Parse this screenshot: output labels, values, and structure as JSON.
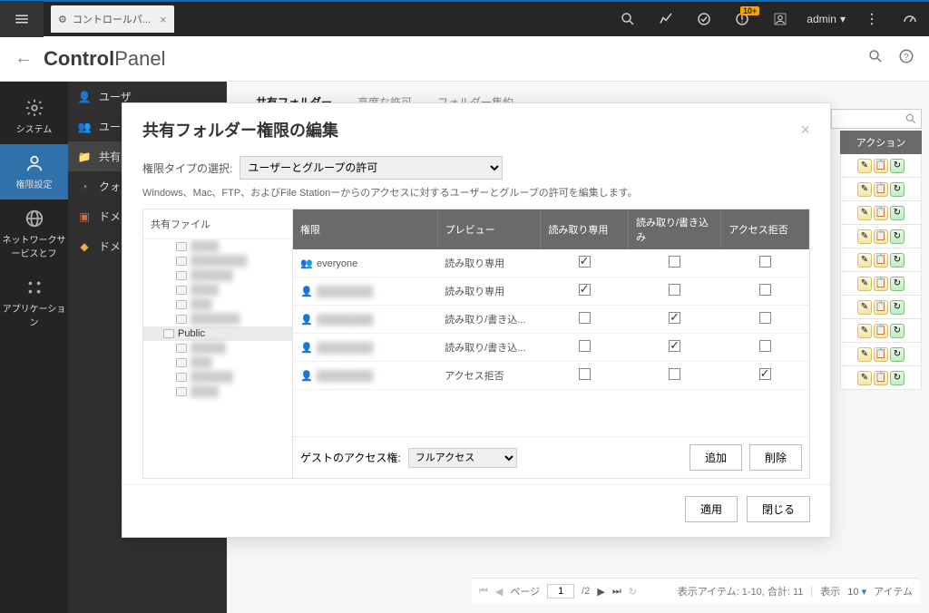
{
  "topbar": {
    "tab_title": "コントロールパ...",
    "notification_badge": "10+",
    "user": "admin"
  },
  "header": {
    "title_bold": "Control",
    "title_light": "Panel"
  },
  "leftbar": {
    "items": [
      {
        "label": "システム"
      },
      {
        "label": "権限設定"
      },
      {
        "label": "ネットワークサービスとフ"
      },
      {
        "label": "アプリケーション"
      }
    ]
  },
  "sublist": {
    "items": [
      {
        "label": "ユーザ"
      },
      {
        "label": "ユー"
      },
      {
        "label": "共有"
      },
      {
        "label": "クォ"
      },
      {
        "label": "ドメ"
      },
      {
        "label": "ドメ"
      }
    ]
  },
  "tabs": {
    "items": [
      "共有フォルダー",
      "高度な許可",
      "フォルダー集約"
    ]
  },
  "bg": {
    "actions_header": "アクション",
    "pager_page_label": "ページ",
    "pager_page": "1",
    "pager_total": "/2",
    "pager_summary": "表示アイテム: 1-10, 合計: 11",
    "pager_show_label": "表示",
    "pager_show_value": "10",
    "pager_items": "アイテム"
  },
  "modal": {
    "title": "共有フォルダー権限の編集",
    "perm_type_label": "権限タイプの選択:",
    "perm_type_value": "ユーザーとグループの許可",
    "desc": "Windows、Mac、FTP、およびFile Stationーからのアクセスに対するユーザーとグループの許可を編集します。",
    "tree_header": "共有ファイル",
    "tree_selected": "Public",
    "table": {
      "headers": [
        "権限",
        "プレビュー",
        "読み取り専用",
        "読み取り/書き込み",
        "アクセス拒否"
      ],
      "rows": [
        {
          "icon": "group",
          "name": "everyone",
          "preview": "読み取り専用",
          "pv_class": "pv-orange",
          "ro": true,
          "rw": false,
          "deny": false
        },
        {
          "icon": "user",
          "name": "",
          "preview": "読み取り専用",
          "pv_class": "pv-orange",
          "ro": true,
          "rw": false,
          "deny": false
        },
        {
          "icon": "user",
          "name": "",
          "preview": "読み取り/書き込...",
          "pv_class": "pv-green",
          "ro": false,
          "rw": true,
          "deny": false
        },
        {
          "icon": "user",
          "name": "",
          "preview": "読み取り/書き込...",
          "pv_class": "pv-green",
          "ro": false,
          "rw": true,
          "deny": false
        },
        {
          "icon": "user",
          "name": "",
          "preview": "アクセス拒否",
          "pv_class": "pv-red",
          "ro": false,
          "rw": false,
          "deny": true
        }
      ]
    },
    "guest_label": "ゲストのアクセス権:",
    "guest_value": "フルアクセス",
    "btn_add": "追加",
    "btn_remove": "削除",
    "btn_apply": "適用",
    "btn_close": "閉じる"
  }
}
